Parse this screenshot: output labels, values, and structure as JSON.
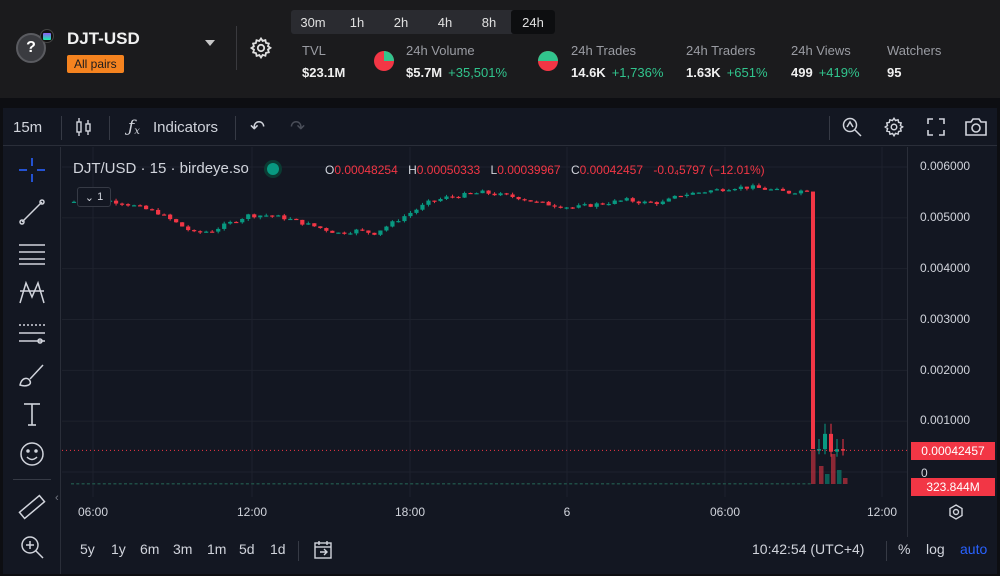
{
  "header": {
    "pair_name": "DJT-USD",
    "all_pairs_label": "All pairs",
    "timeframes": [
      "30m",
      "1h",
      "2h",
      "4h",
      "8h",
      "24h"
    ],
    "active_timeframe": "24h",
    "stats": {
      "tvl": {
        "label": "TVL",
        "value": "$23.1M"
      },
      "volume": {
        "label": "24h Volume",
        "value": "$5.7M",
        "change": "+35,501%"
      },
      "trades": {
        "label": "24h Trades",
        "value": "14.6K",
        "change": "+1,736%"
      },
      "traders": {
        "label": "24h Traders",
        "value": "1.63K",
        "change": "+651%"
      },
      "views": {
        "label": "24h Views",
        "value": "499",
        "change": "+419%"
      },
      "watchers": {
        "label": "Watchers",
        "value": "95"
      }
    }
  },
  "toolbar": {
    "interval": "15m",
    "indicators_label": "Indicators"
  },
  "legend": {
    "symbol_line": "DJT/USD · 15 · birdeye.so",
    "open_key": "O",
    "open": "0.00048254",
    "high_key": "H",
    "high": "0.00050333",
    "low_key": "L",
    "low": "0.00039967",
    "close_key": "C",
    "close": "0.00042457",
    "change": "-0.0₄5797 (−12.01%)",
    "collapsed_count": "1"
  },
  "price_scale": {
    "labels": [
      "0.006000",
      "0.005000",
      "0.004000",
      "0.003000",
      "0.002000",
      "0.001000"
    ],
    "last_price": "0.00042457",
    "zero": "0",
    "volume": "323.844M"
  },
  "time_scale": {
    "labels": [
      "06:00",
      "12:00",
      "18:00",
      "6",
      "06:00",
      "12:00"
    ]
  },
  "bottom_bar": {
    "ranges": [
      "5y",
      "1y",
      "6m",
      "3m",
      "1m",
      "5d",
      "1d"
    ],
    "clock": "10:42:54 (UTC+4)",
    "percent": "%",
    "log": "log",
    "auto": "auto"
  },
  "colors": {
    "up": "#089981",
    "down": "#f23645",
    "accent": "#f5831f",
    "positive_change": "#31c48d"
  },
  "chart_data": {
    "type": "candlestick",
    "ylim": [
      0,
      0.006
    ],
    "price_ticks": [
      0.006,
      0.005,
      0.004,
      0.003,
      0.002,
      0.001,
      0
    ],
    "x_ticks": [
      "06:00",
      "12:00",
      "18:00",
      "6",
      "06:00",
      "12:00"
    ],
    "last_close": 0.00042457,
    "path_close": [
      0.0053,
      0.00535,
      0.00535,
      0.0053,
      0.0052,
      0.0051,
      0.0049,
      0.0047,
      0.00475,
      0.0049,
      0.00505,
      0.00505,
      0.005,
      0.0049,
      0.0048,
      0.0047,
      0.00475,
      0.0047,
      0.0049,
      0.0051,
      0.0053,
      0.0054,
      0.00545,
      0.0055,
      0.00545,
      0.0054,
      0.0053,
      0.00525,
      0.0052,
      0.00525,
      0.0053,
      0.00535,
      0.0053,
      0.0053,
      0.00545,
      0.0055,
      0.00555,
      0.0056,
      0.0056,
      0.00555,
      0.0055,
      0.00555,
      0.00045,
      0.00075,
      0.0004,
      0.00045,
      0.00042457
    ]
  }
}
